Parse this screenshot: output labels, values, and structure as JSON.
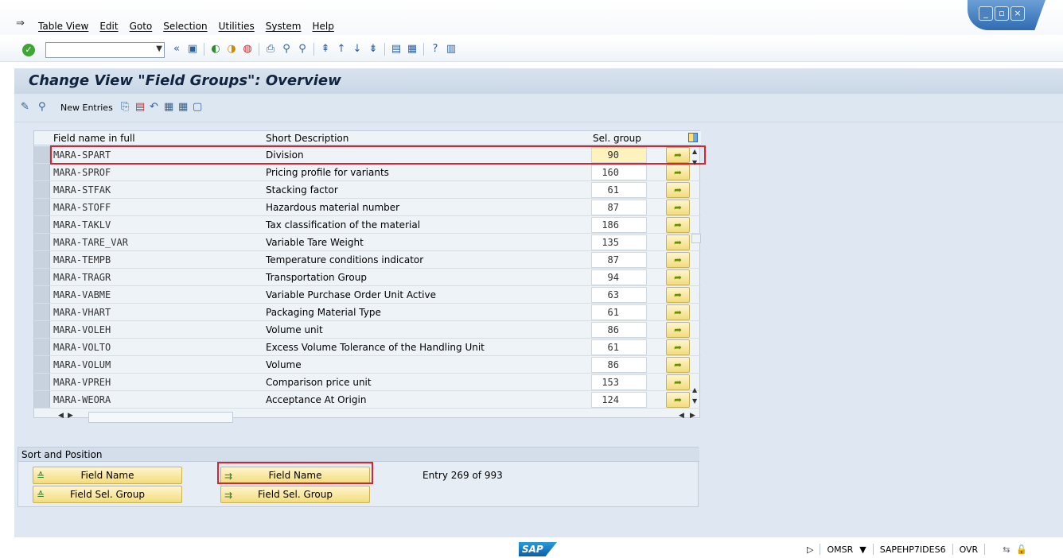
{
  "menu": {
    "items": [
      "Table View",
      "Edit",
      "Goto",
      "Selection",
      "Utilities",
      "System",
      "Help"
    ]
  },
  "title": "Change View \"Field Groups\": Overview",
  "app_toolbar": {
    "new_entries": "New Entries"
  },
  "table": {
    "columns": {
      "field_name": "Field name in full",
      "short_desc": "Short Description",
      "sel_group": "Sel. group"
    },
    "rows": [
      {
        "field": "MARA-SPART",
        "desc": "Division",
        "group": "90"
      },
      {
        "field": "MARA-SPROF",
        "desc": "Pricing profile for variants",
        "group": "160"
      },
      {
        "field": "MARA-STFAK",
        "desc": "Stacking factor",
        "group": "61"
      },
      {
        "field": "MARA-STOFF",
        "desc": "Hazardous material number",
        "group": "87"
      },
      {
        "field": "MARA-TAKLV",
        "desc": "Tax classification of the material",
        "group": "186"
      },
      {
        "field": "MARA-TARE_VAR",
        "desc": "Variable Tare Weight",
        "group": "135"
      },
      {
        "field": "MARA-TEMPB",
        "desc": "Temperature conditions indicator",
        "group": "87"
      },
      {
        "field": "MARA-TRAGR",
        "desc": "Transportation Group",
        "group": "94"
      },
      {
        "field": "MARA-VABME",
        "desc": "Variable Purchase Order Unit Active",
        "group": "63"
      },
      {
        "field": "MARA-VHART",
        "desc": "Packaging Material Type",
        "group": "61"
      },
      {
        "field": "MARA-VOLEH",
        "desc": "Volume unit",
        "group": "86"
      },
      {
        "field": "MARA-VOLTO",
        "desc": "Excess Volume Tolerance of the Handling Unit",
        "group": "61"
      },
      {
        "field": "MARA-VOLUM",
        "desc": "Volume",
        "group": "86"
      },
      {
        "field": "MARA-VPREH",
        "desc": "Comparison price unit",
        "group": "153"
      },
      {
        "field": "MARA-WEORA",
        "desc": "Acceptance At Origin",
        "group": "124"
      }
    ]
  },
  "sort_position": {
    "caption": "Sort and Position",
    "btn_field_name": "Field Name",
    "btn_field_sel_group": "Field Sel. Group",
    "btn_pos_field_name": "Field Name",
    "btn_pos_field_sel_group": "Field Sel. Group",
    "entry_text": "Entry 269 of 993"
  },
  "status": {
    "system": "OMSR",
    "server": "SAPEHP7IDES6",
    "mode": "OVR",
    "logo": "SAP"
  }
}
